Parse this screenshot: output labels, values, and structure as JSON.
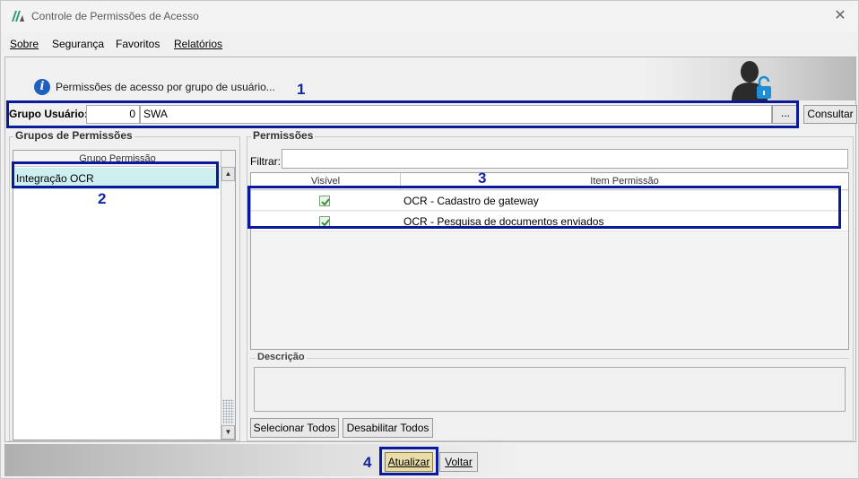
{
  "window": {
    "title": "Controle de Permissões de Acesso"
  },
  "menu": [
    "Sobre",
    "Segurança",
    "Favoritos",
    "Relatórios"
  ],
  "header": {
    "info_text": "Permissões de acesso por grupo de usuário..."
  },
  "grupo_usuario": {
    "label": "Grupo Usuário:",
    "code": "0",
    "name": "SWA",
    "browse_label": "...",
    "consultar_label": "Consultar"
  },
  "grupos_permissoes": {
    "title": "Grupos de Permissões",
    "column_header": "Grupo Permissão",
    "items": [
      "Integração OCR"
    ]
  },
  "permissoes": {
    "title": "Permissões",
    "filter_label": "Filtrar:",
    "filter_value": "",
    "columns": [
      "Visível",
      "Item Permissão"
    ],
    "rows": [
      {
        "visible": true,
        "item": "OCR - Cadastro de gateway"
      },
      {
        "visible": true,
        "item": "OCR - Pesquisa de documentos enviados"
      }
    ],
    "descricao_title": "Descrição",
    "descricao_value": "",
    "select_all_label": "Selecionar Todos",
    "disable_all_label": "Desabilitar Todos"
  },
  "footer": {
    "atualizar_label": "Atualizar",
    "voltar_label": "Voltar"
  },
  "annotations": [
    "1",
    "2",
    "3",
    "4"
  ],
  "colors": {
    "annotation": "#0b1a9a",
    "selected_row": "#cdeff0",
    "info_icon": "#1f5fbf"
  }
}
